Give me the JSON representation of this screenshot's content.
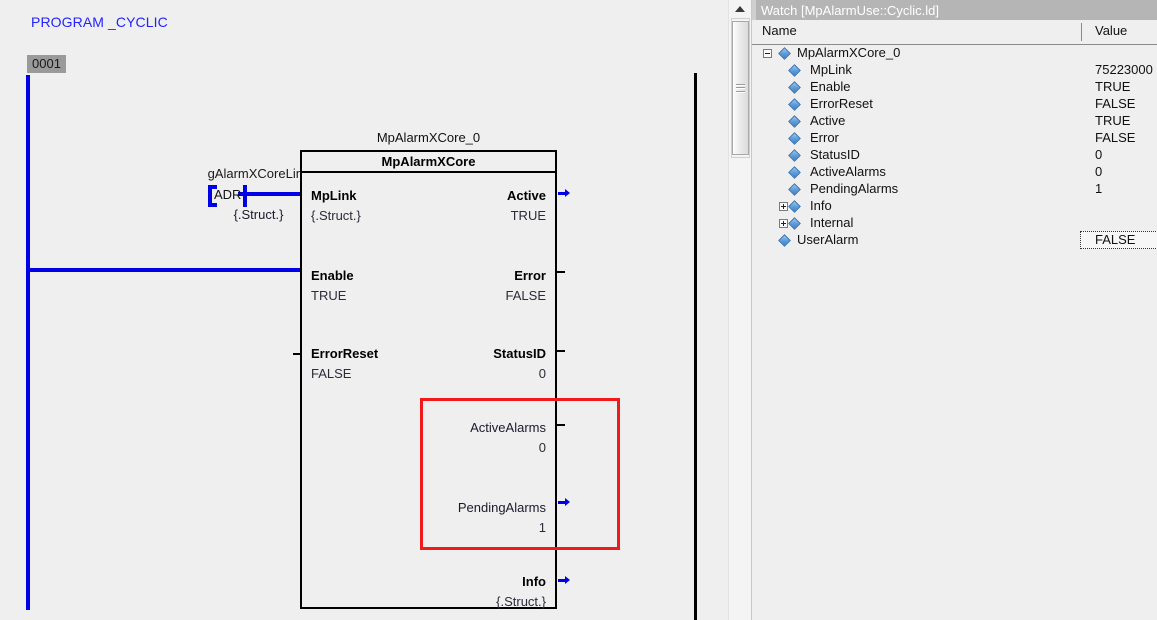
{
  "editor": {
    "program_title": "PROGRAM _CYCLIC",
    "rung_number": "0001",
    "contact": {
      "variable": "gAlarmXCoreLink",
      "label": "ADR",
      "type": "{.Struct.}"
    },
    "function_block": {
      "instance_name": "MpAlarmXCore_0",
      "type_name": "MpAlarmXCore",
      "inputs": [
        {
          "name": "MpLink",
          "value": "{.Struct.}",
          "connector": "wire"
        },
        {
          "name": "Enable",
          "value": "TRUE",
          "connector": "wire"
        },
        {
          "name": "ErrorReset",
          "value": "FALSE",
          "connector": "stub"
        }
      ],
      "outputs": [
        {
          "name": "Active",
          "value": "TRUE",
          "connector": "arrow"
        },
        {
          "name": "Error",
          "value": "FALSE",
          "connector": "stub"
        },
        {
          "name": "StatusID",
          "value": "0",
          "connector": "stub"
        },
        {
          "name": "ActiveAlarms",
          "value": "0",
          "connector": "stub"
        },
        {
          "name": "PendingAlarms",
          "value": "1",
          "connector": "arrow"
        },
        {
          "name": "Info",
          "value": "{.Struct.}",
          "connector": "arrow"
        }
      ]
    },
    "highlight_color": "#f01a1a",
    "wire_color": "#0000e6"
  },
  "watch": {
    "title": "Watch [MpAlarmUse::Cyclic.ld]",
    "columns": {
      "name": "Name",
      "value": "Value"
    },
    "rows": [
      {
        "name": "MpAlarmXCore_0",
        "value": "",
        "depth": 0,
        "expander": "minus",
        "focused": false
      },
      {
        "name": "MpLink",
        "value": "75223000",
        "depth": 1,
        "expander": "none",
        "focused": false
      },
      {
        "name": "Enable",
        "value": "TRUE",
        "depth": 1,
        "expander": "none",
        "focused": false
      },
      {
        "name": "ErrorReset",
        "value": "FALSE",
        "depth": 1,
        "expander": "none",
        "focused": false
      },
      {
        "name": "Active",
        "value": "TRUE",
        "depth": 1,
        "expander": "none",
        "focused": false
      },
      {
        "name": "Error",
        "value": "FALSE",
        "depth": 1,
        "expander": "none",
        "focused": false
      },
      {
        "name": "StatusID",
        "value": "0",
        "depth": 1,
        "expander": "none",
        "focused": false
      },
      {
        "name": "ActiveAlarms",
        "value": "0",
        "depth": 1,
        "expander": "none",
        "focused": false
      },
      {
        "name": "PendingAlarms",
        "value": "1",
        "depth": 1,
        "expander": "none",
        "focused": false
      },
      {
        "name": "Info",
        "value": "",
        "depth": 1,
        "expander": "plus",
        "focused": false
      },
      {
        "name": "Internal",
        "value": "",
        "depth": 1,
        "expander": "plus",
        "focused": false
      },
      {
        "name": "UserAlarm",
        "value": "FALSE",
        "depth": 0,
        "expander": "none",
        "focused": true
      }
    ]
  },
  "scrollbar": {
    "up_arrow_icon": "scroll-up-icon",
    "grip_icon": "scrollbar-grip-icon"
  }
}
